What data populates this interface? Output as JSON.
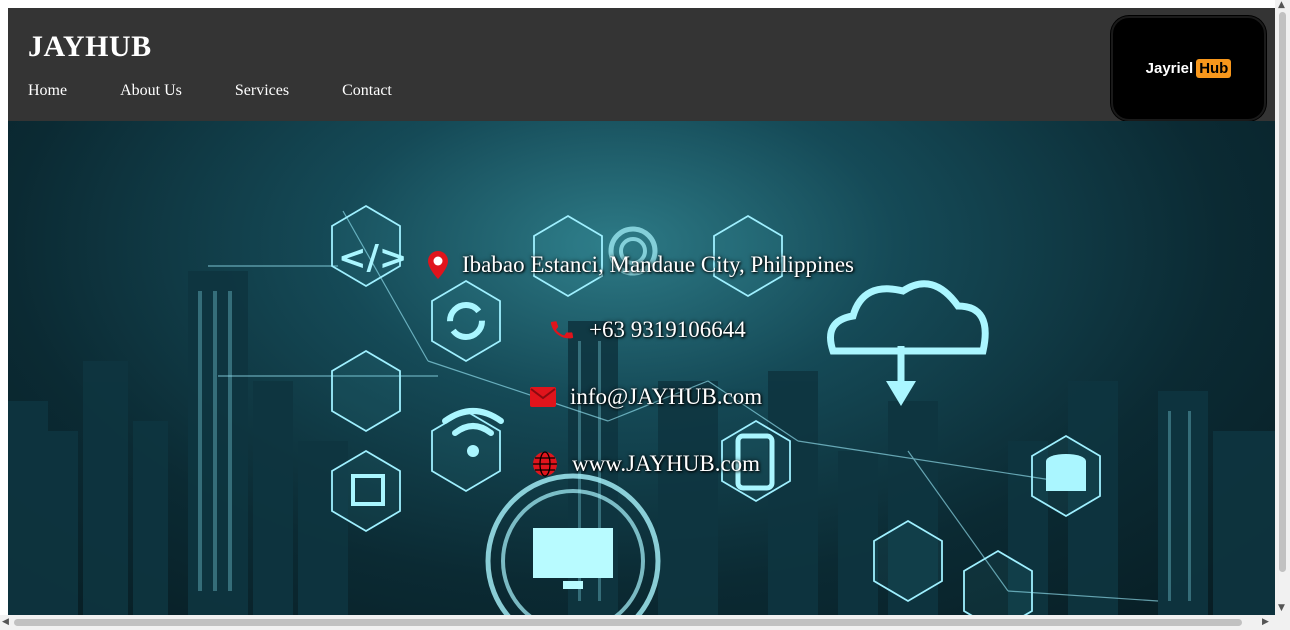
{
  "header": {
    "brand": "JAYHUB",
    "nav": [
      "Home",
      "About Us",
      "Services",
      "Contact"
    ],
    "logo": {
      "word": "Jayriel",
      "highlight": "Hub",
      "highlight_color": "#f7971c"
    }
  },
  "contact": {
    "address": "Ibabao Estanci, Mandaue City, Philippines",
    "phone": "+63 9319106644",
    "email": "info@JAYHUB.com",
    "website": "www.JAYHUB.com",
    "icon_color": "#e0141c"
  },
  "icons": [
    "map-pin-icon",
    "phone-icon",
    "envelope-icon",
    "globe-icon"
  ],
  "colors": {
    "header_bg": "#343434",
    "hero_tint": "#0b2a33",
    "text": "#ffffff"
  }
}
